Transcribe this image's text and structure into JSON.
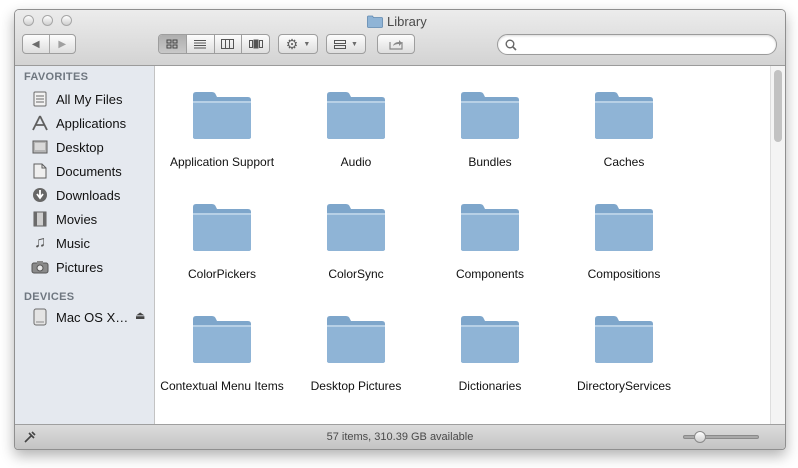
{
  "window": {
    "title": "Library",
    "title_icon": "folder-icon"
  },
  "toolbar": {
    "nav": [
      "back-icon",
      "forward-icon"
    ],
    "view_modes": [
      "icon-view-icon",
      "list-view-icon",
      "column-view-icon",
      "coverflow-view-icon"
    ],
    "selected_view": "icon",
    "action_menu": "gear-icon",
    "arrange_menu": "arrange-icon",
    "share": "share-icon",
    "search": {
      "value": "",
      "placeholder": ""
    }
  },
  "sidebar": {
    "favorites_header": "FAVORITES",
    "favorites": [
      {
        "label": "All My Files",
        "icon": "all-my-files-icon"
      },
      {
        "label": "Applications",
        "icon": "applications-icon"
      },
      {
        "label": "Desktop",
        "icon": "desktop-icon"
      },
      {
        "label": "Documents",
        "icon": "documents-icon"
      },
      {
        "label": "Downloads",
        "icon": "downloads-icon"
      },
      {
        "label": "Movies",
        "icon": "movies-icon"
      },
      {
        "label": "Music",
        "icon": "music-icon"
      },
      {
        "label": "Pictures",
        "icon": "pictures-icon"
      }
    ],
    "devices_header": "DEVICES",
    "devices": [
      {
        "label": "Mac OS X…",
        "icon": "hard-drive-icon",
        "eject": "eject-icon"
      }
    ]
  },
  "content": {
    "items": [
      {
        "label": "Application Support"
      },
      {
        "label": "Audio"
      },
      {
        "label": "Bundles"
      },
      {
        "label": "Caches"
      },
      {
        "label": "ColorPickers"
      },
      {
        "label": "ColorSync"
      },
      {
        "label": "Components"
      },
      {
        "label": "Compositions"
      },
      {
        "label": "Contextual Menu Items"
      },
      {
        "label": "Desktop Pictures"
      },
      {
        "label": "Dictionaries"
      },
      {
        "label": "DirectoryServices"
      }
    ]
  },
  "statusbar": {
    "text": "57 items, 310.39 GB available",
    "zoom_level": 0.15
  },
  "colors": {
    "folder": "#8fb4d6",
    "sidebar_bg": "#e5e9ef",
    "titlebar": "#d9d9d9"
  }
}
